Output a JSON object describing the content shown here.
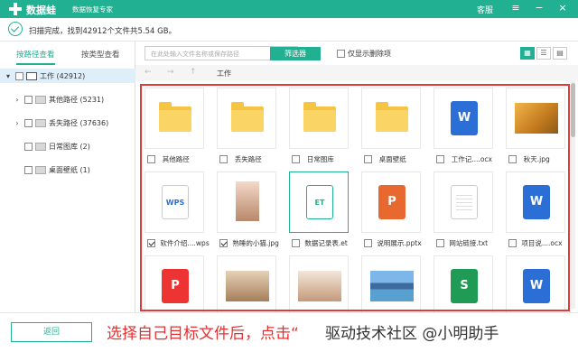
{
  "app": {
    "brand": "数据蛙",
    "slogan": "数据恢复专家",
    "menu_service": "客服",
    "menu_more": "≡",
    "win_min": "−",
    "win_close": "×"
  },
  "status": {
    "text": "扫描完成，找到42912个文件共5.54 GB。"
  },
  "sidebar": {
    "tab_path": "按路径查看",
    "tab_type": "按类型查看",
    "root": {
      "label": "工作 (42912)",
      "expanded_icon": "▾"
    },
    "items": [
      {
        "label": "其他路径 (5231)",
        "arrow": "›"
      },
      {
        "label": "丢失路径 (37636)",
        "arrow": "›"
      },
      {
        "label": "日常图库 (2)",
        "arrow": ""
      },
      {
        "label": "桌面壁纸 (1)",
        "arrow": ""
      }
    ]
  },
  "toolbar": {
    "search_placeholder": "在此处输入文件名称或保存路径",
    "filter_label": "筛选器",
    "only_deleted_label": "仅显示删除项"
  },
  "nav": {
    "back": "←",
    "forward": "→",
    "up": "↑",
    "path": "工作"
  },
  "grid": {
    "row1": [
      {
        "caption": "其他路径",
        "checked": false
      },
      {
        "caption": "丢失路径",
        "checked": false
      },
      {
        "caption": "日常图库",
        "checked": false
      },
      {
        "caption": "桌面壁纸",
        "checked": false
      },
      {
        "caption": "工作记....ocx",
        "checked": false,
        "badge": "W"
      },
      {
        "caption": "秋天.jpg",
        "checked": false
      }
    ],
    "row2": [
      {
        "caption": "软件介绍....wps",
        "checked": true,
        "badge": "WPS"
      },
      {
        "caption": "熟睡的小猫.jpg",
        "checked": true
      },
      {
        "caption": "数据记录表.et",
        "checked": false,
        "badge": "ET"
      },
      {
        "caption": "说明展示.pptx",
        "checked": false,
        "badge": "P"
      },
      {
        "caption": "网站链接.txt",
        "checked": false
      },
      {
        "caption": "项目说....ocx",
        "checked": false,
        "badge": "W"
      }
    ],
    "row3": [
      {
        "badge": "P"
      },
      {},
      {},
      {},
      {
        "badge": "S"
      },
      {
        "badge": "W"
      }
    ]
  },
  "bottom": {
    "back_label": "返回",
    "instruction": "选择自己目标文件后，点击“",
    "watermark": "驱动技术社区 @小明助手"
  },
  "colors": {
    "brand": "#21b092",
    "highlight": "#e23a3a"
  }
}
